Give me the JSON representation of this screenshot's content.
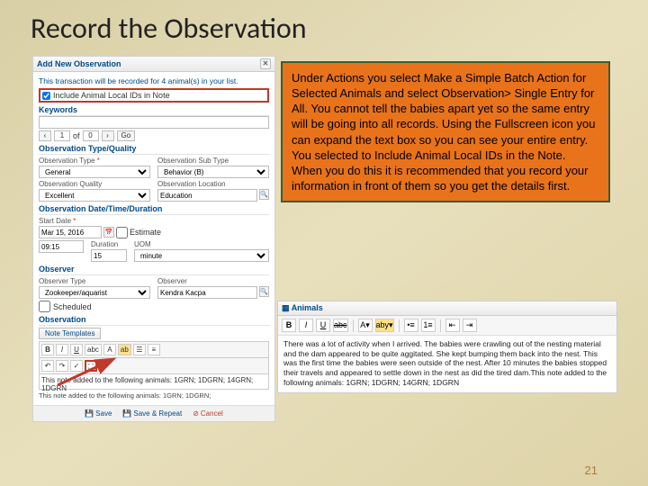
{
  "title": "Record the Observation",
  "page_number": "21",
  "callout_text": "Under Actions you select Make a Simple Batch Action for Selected Animals and select Observation> Single Entry for All. You cannot tell the babies apart yet so the same entry will be going into all records. Using the Fullscreen icon you can expand the text box so you can see your entire entry. You selected to Include Animal Local IDs in the Note. When you do this it is recommended that you record your information in front of them so you get the details first.",
  "panel": {
    "header": "Add New Observation",
    "info": "This transaction will be recorded for 4 animal(s) in your list.",
    "include_label": "Include Animal Local IDs in Note",
    "include_checked": true,
    "keywords_h": "Keywords",
    "nav": {
      "of": "of",
      "current": "1",
      "total": "0",
      "go": "Go"
    },
    "type_h": "Observation Type/Quality",
    "obs_type_lbl": "Observation Type",
    "obs_type_val": "General",
    "obs_sub_lbl": "Observation Sub Type",
    "obs_sub_val": "Behavior (B)",
    "quality_lbl": "Observation Quality",
    "quality_val": "Excellent",
    "location_lbl": "Observation Location",
    "location_val": "Education",
    "dt_h": "Observation Date/Time/Duration",
    "start_lbl": "Start Date",
    "start_val": "Mar 15, 2016",
    "estimate_lbl": "Estimate",
    "time_val": "09:15",
    "duration_lbl": "Duration",
    "duration_val": "15",
    "uom_lbl": "UOM",
    "uom_val": "minute",
    "observer_h": "Observer",
    "observer_type_lbl": "Observer Type",
    "observer_type_val": "Zookeeper/aquarist",
    "observer_lbl": "Observer",
    "observer_val": "Kendra Kacpa",
    "scheduled_lbl": "Scheduled",
    "observation_h": "Observation",
    "note_templates_btn": "Note Templates",
    "rte_footnote": "This note added to the following animals: 1GRN; 1DGRN;",
    "mini_editor_text": "This note added to the following animals: 1GRN; 1DGRN; 14GRN; 1DGRN",
    "save": "Save",
    "save_repeat": "Save & Repeat",
    "cancel": "Cancel"
  },
  "zoom": {
    "header": "Animals",
    "text": "There was a lot of activity when I arrived. The babies were crawling out of the nesting material and the dam appeared to be quite aggitated. She kept bumping them back into the nest. This was the first time the babies were seen outside of the nest. After 10 minutes the babies stopped their travels and appeared to settle down in the nest as did the tired dam.This note added to the following animals: 1GRN; 1DGRN; 14GRN; 1DGRN"
  }
}
